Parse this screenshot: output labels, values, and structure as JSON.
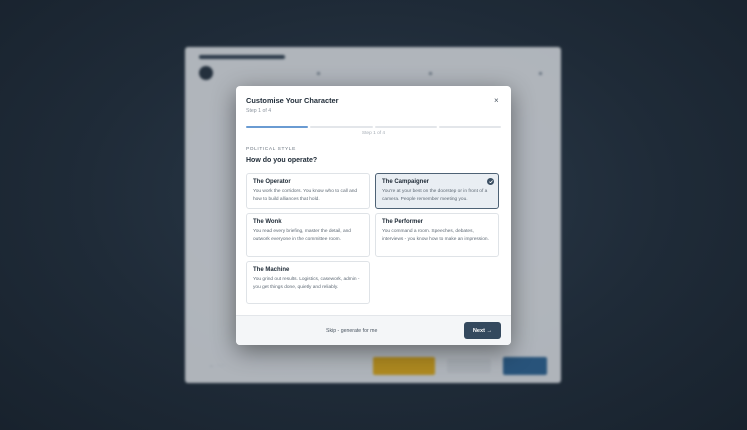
{
  "modal": {
    "title": "Customise Your Character",
    "subtitle": "Step 1 of 4",
    "close_icon": "×",
    "progress_text": "Step 1 of 4",
    "progress": {
      "current": 1,
      "total": 4
    },
    "section_label": "POLITICAL STYLE",
    "question": "How do you operate?"
  },
  "options": [
    {
      "title": "The Operator",
      "description": "You work the corridors. You know who to call and how to build alliances that hold.",
      "selected": false
    },
    {
      "title": "The Campaigner",
      "description": "You're at your best on the doorstep or in front of a camera. People remember meeting you.",
      "selected": true
    },
    {
      "title": "The Wonk",
      "description": "You read every briefing, master the detail, and outwork everyone in the committee room.",
      "selected": false
    },
    {
      "title": "The Performer",
      "description": "You command a room. Speeches, debates, interviews - you know how to make an impression.",
      "selected": false
    },
    {
      "title": "The Machine",
      "description": "You grind out results. Logistics, casework, admin - you get things done, quietly and reliably.",
      "selected": false
    }
  ],
  "footer": {
    "skip_label": "Skip - generate for me",
    "next_label": "Next →"
  },
  "colors": {
    "accent": "#34495e",
    "progress_active": "#6a9bd2",
    "selected_bg": "#e9eef3"
  }
}
